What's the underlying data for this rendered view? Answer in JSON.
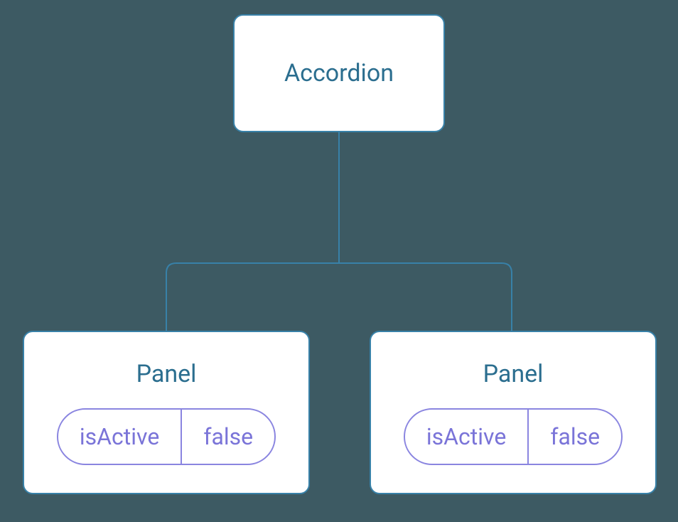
{
  "root": {
    "label": "Accordion"
  },
  "children": [
    {
      "label": "Panel",
      "prop": {
        "key": "isActive",
        "value": "false"
      }
    },
    {
      "label": "Panel",
      "prop": {
        "key": "isActive",
        "value": "false"
      }
    }
  ],
  "colors": {
    "background": "#3d5a63",
    "nodeBorder": "#3881a8",
    "nodeText": "#2b6e8f",
    "pillBorder": "#8a85e0",
    "pillText": "#7a74d8"
  }
}
